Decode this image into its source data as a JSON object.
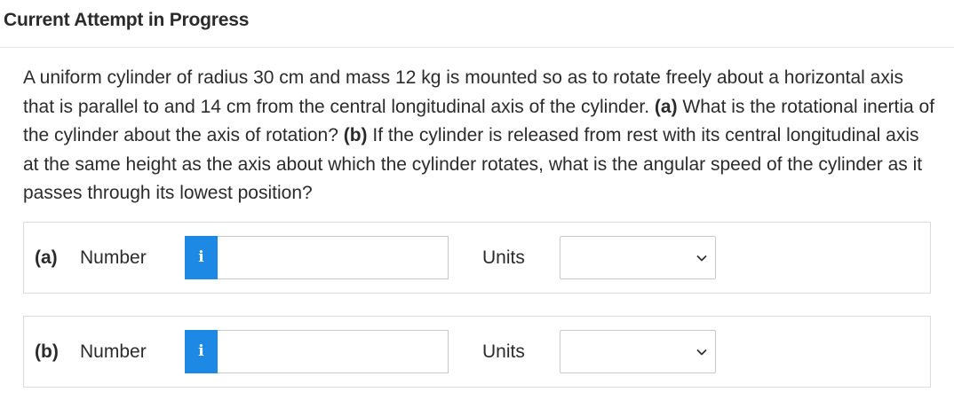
{
  "header": {
    "title": "Current Attempt in Progress"
  },
  "question": {
    "intro": "A uniform cylinder of radius 30 cm and mass 12 kg is mounted so as to rotate freely about a horizontal axis that is parallel to and 14 cm from the central longitudinal axis of the cylinder.",
    "part_a_marker": "(a)",
    "part_a_text": "What is the rotational inertia of the cylinder about the axis of rotation?",
    "part_b_marker": "(b)",
    "part_b_text": "If the cylinder is released from rest with its central longitudinal axis at the same height as the axis about which the cylinder rotates, what is the angular speed of the cylinder as it passes through its lowest position?"
  },
  "answers": [
    {
      "part_label": "(a)",
      "number_label": "Number",
      "info_icon": "i",
      "number_value": "",
      "units_label": "Units",
      "units_value": ""
    },
    {
      "part_label": "(b)",
      "number_label": "Number",
      "info_icon": "i",
      "number_value": "",
      "units_label": "Units",
      "units_value": ""
    }
  ],
  "colors": {
    "info_button": "#1e88e5",
    "border": "#dcdcdc",
    "text": "#2b2b2b"
  },
  "icons": {
    "info": "info-icon",
    "dropdown": "chevron-down-icon"
  }
}
